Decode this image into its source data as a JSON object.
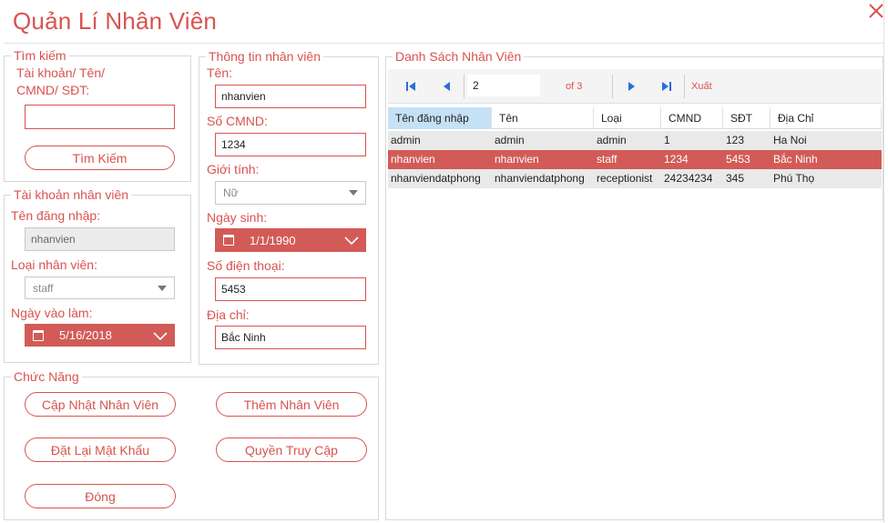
{
  "window": {
    "title": "Quản Lí Nhân Viên",
    "close_icon": "close-icon"
  },
  "search": {
    "legend": "Tìm kiếm",
    "label": "Tài khoản/ Tên/\nCMND/ SĐT:",
    "label_line1": "Tài khoản/ Tên/",
    "label_line2": "CMND/ SĐT:",
    "value": "",
    "button": "Tìm Kiếm"
  },
  "account": {
    "legend": "Tài khoản nhân viên",
    "username_label": "Tên đăng nhập:",
    "username_value": "nhanvien",
    "type_label": "Loại nhân viên:",
    "type_value": "staff",
    "start_label": "Ngày vào làm:",
    "start_value": "5/16/2018"
  },
  "info": {
    "legend": "Thông tin nhân viên",
    "name_label": "Tên:",
    "name_value": "nhanvien",
    "id_label": "Số CMND:",
    "id_value": "1234",
    "gender_label": "Giới tính:",
    "gender_value": "Nữ",
    "dob_label": "Ngày sinh:",
    "dob_value": "1/1/1990",
    "phone_label": "Số điện thoại:",
    "phone_value": "5453",
    "address_label": "Địa chỉ:",
    "address_value": "Bắc Ninh"
  },
  "functions": {
    "legend": "Chức Năng",
    "update": "Cập Nhật Nhân Viên",
    "add": "Thêm Nhân Viên",
    "reset_password": "Đặt Lại Mật Khẩu",
    "access": "Quyền Truy Cập",
    "close": "Đóng"
  },
  "list": {
    "legend": "Danh Sách Nhân Viên",
    "page": "2",
    "of": "of 3",
    "export": "Xuất",
    "columns": [
      "Tên đăng nhập",
      "Tên",
      "Loại",
      "CMND",
      "SĐT",
      "Địa Chỉ"
    ],
    "rows": [
      [
        "admin",
        "admin",
        "admin",
        "1",
        "123",
        "Ha Noi"
      ],
      [
        "nhanvien",
        "nhanvien",
        "staff",
        "1234",
        "5453",
        "Bắc Ninh"
      ],
      [
        "nhanviendatphong",
        "nhanviendatphong",
        "receptionist",
        "24234234",
        "345",
        "Phú Thọ"
      ]
    ],
    "selected_row": 1
  },
  "colors": {
    "accent": "#d9534f",
    "selected_row": "#d25b57",
    "header_selected": "#c5e1f5",
    "alt_row": "#e9e9e9"
  }
}
